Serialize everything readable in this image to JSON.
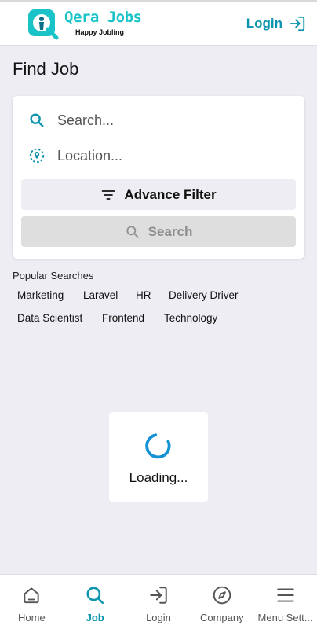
{
  "header": {
    "logo_title": "Qera Jobs",
    "logo_tagline": "Happy Jobling",
    "login_label": "Login"
  },
  "page": {
    "title": "Find Job"
  },
  "search": {
    "keyword_placeholder": "Search...",
    "location_placeholder": "Location...",
    "advance_filter_label": "Advance Filter",
    "search_button_label": "Search"
  },
  "popular": {
    "label": "Popular Searches",
    "tags": [
      "Marketing",
      "Laravel",
      "HR",
      "Delivery Driver",
      "Data Scientist",
      "Frontend",
      "Technology"
    ]
  },
  "loading": {
    "text": "Loading..."
  },
  "bottom_nav": {
    "items": [
      {
        "label": "Home",
        "icon": "home-icon"
      },
      {
        "label": "Job",
        "icon": "search-icon"
      },
      {
        "label": "Login",
        "icon": "login-icon"
      },
      {
        "label": "Company",
        "icon": "compass-icon"
      },
      {
        "label": "Menu Sett...",
        "icon": "menu-icon"
      }
    ],
    "active_index": 1
  },
  "colors": {
    "accent": "#0a94ad",
    "logo": "#19c3c7",
    "background": "#ededf3",
    "disabled_button": "#dedede"
  }
}
